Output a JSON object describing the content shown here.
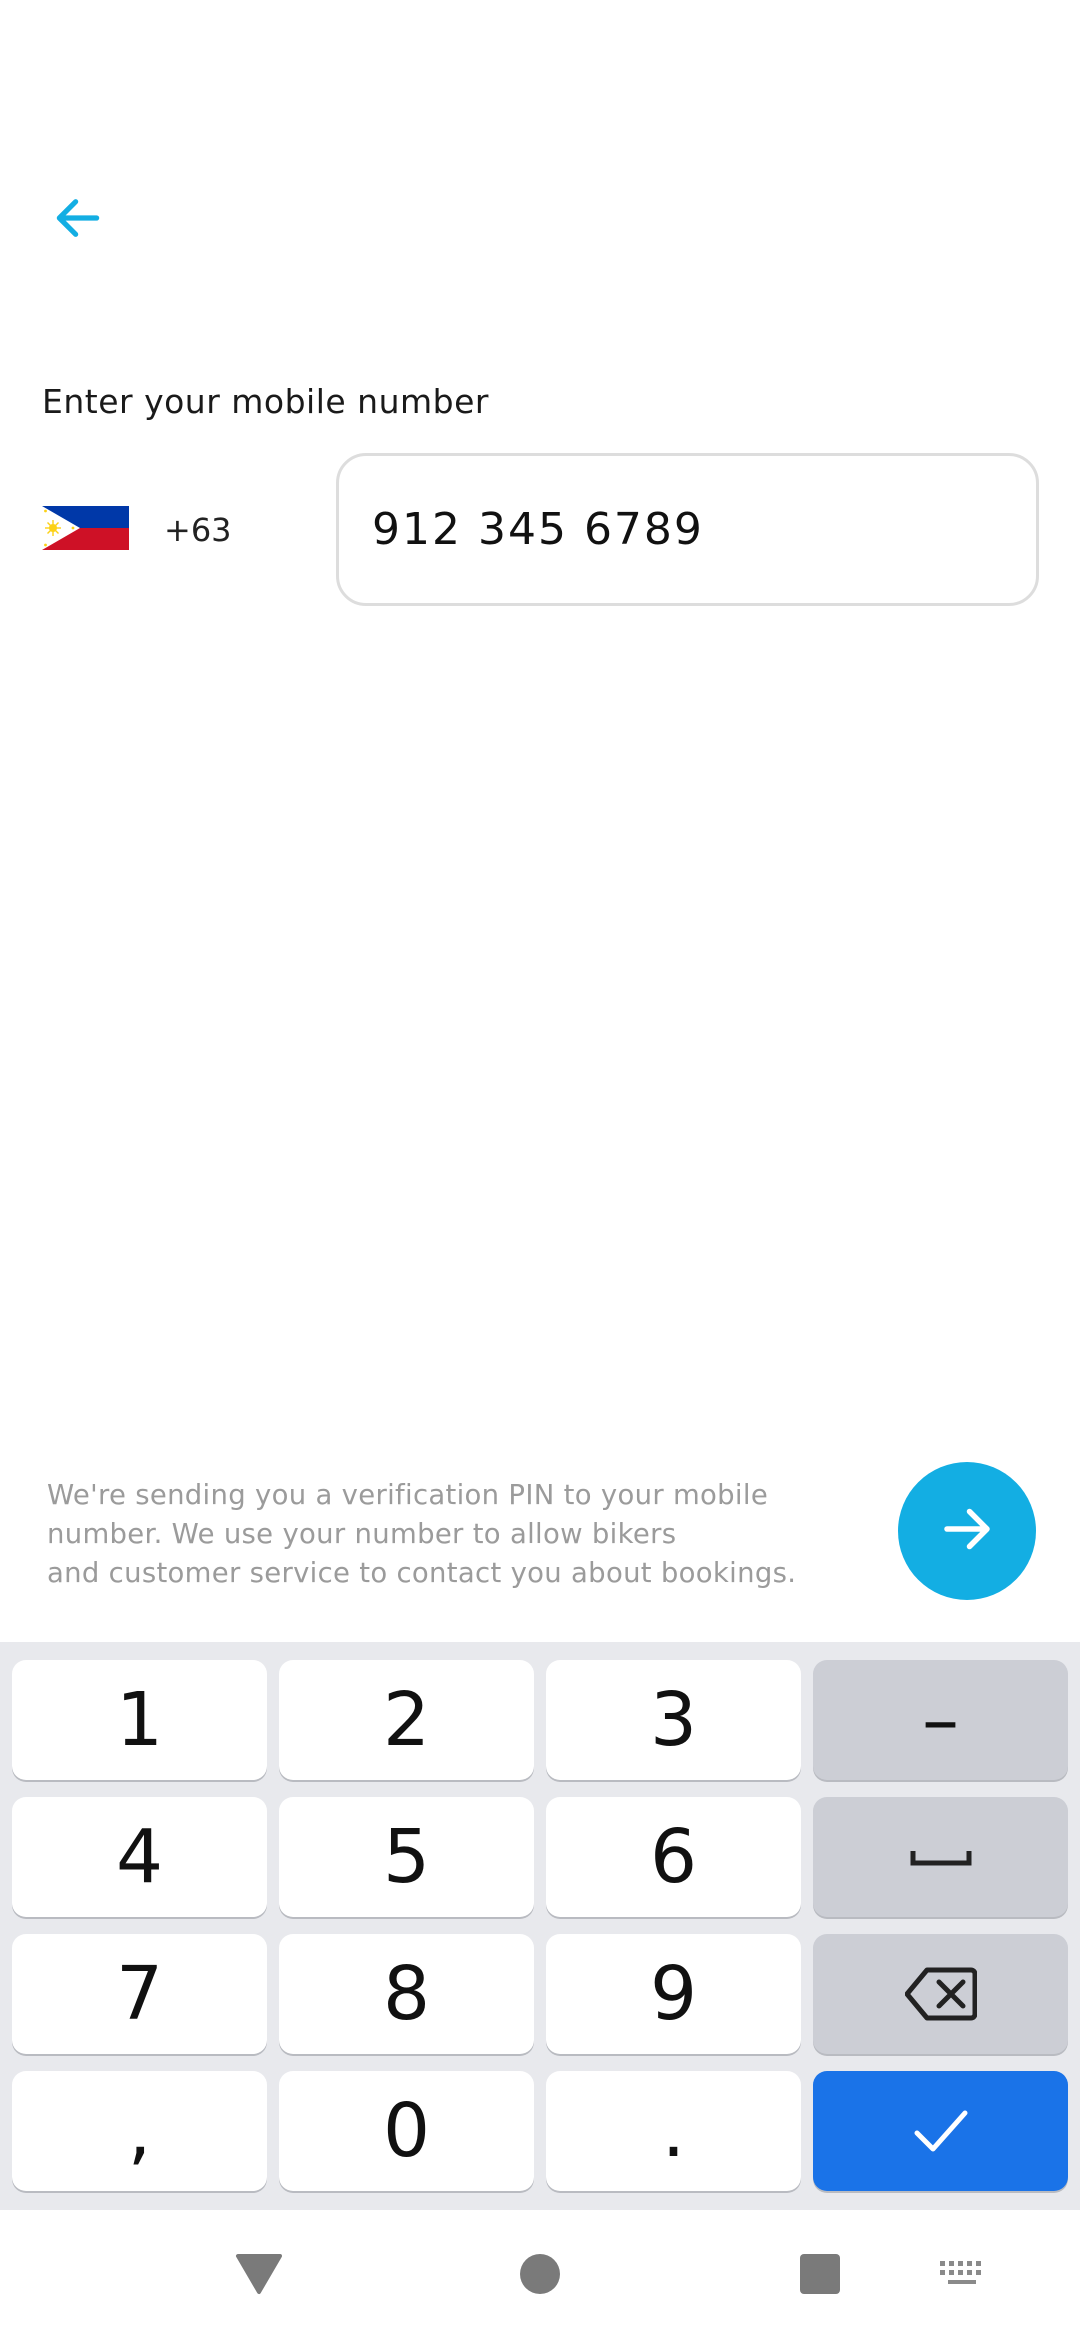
{
  "header": {
    "back_icon": "arrow-left-icon",
    "accent_color": "#13aee3"
  },
  "form": {
    "title": "Enter your mobile number",
    "country": {
      "flag_icon": "philippines-flag-icon",
      "dial_code": "+63"
    },
    "phone_value": "912 345 6789"
  },
  "notice": {
    "lines": [
      "We're sending you a verification PIN to your mobile",
      "number. We use your number to allow bikers",
      "and customer service to contact you about bookings."
    ]
  },
  "next_button": {
    "icon": "arrow-right-icon"
  },
  "keyboard": {
    "digits": [
      "1",
      "2",
      "3",
      "4",
      "5",
      "6",
      "7",
      "8",
      "9",
      ",",
      "0",
      "."
    ],
    "function_keys": {
      "minus": "–",
      "space_icon": "space-icon",
      "backspace_icon": "backspace-icon",
      "enter_icon": "check-icon"
    },
    "enter_color": "#1a73e8"
  },
  "navbar": {
    "back_icon": "nav-back-triangle-icon",
    "home_icon": "nav-home-circle-icon",
    "recents_icon": "nav-recents-square-icon",
    "keyboard_icon": "keyboard-switch-icon"
  }
}
